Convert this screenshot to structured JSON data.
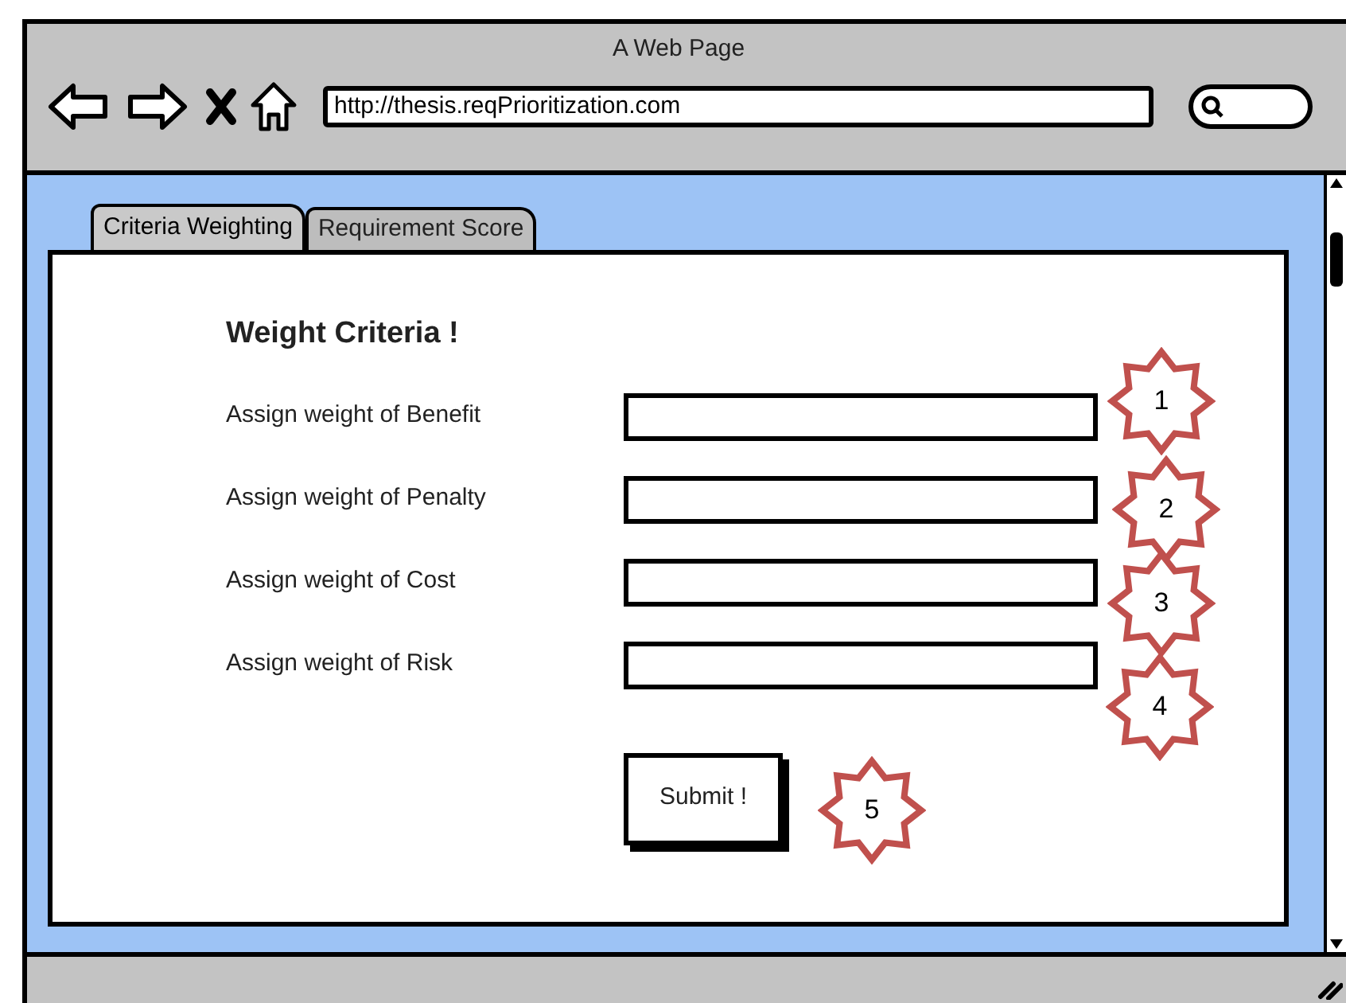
{
  "window": {
    "title": "A Web Page"
  },
  "address_bar": {
    "value": "http://thesis.reqPrioritization.com"
  },
  "tabs": [
    {
      "label": "Criteria Weighting",
      "selected": true
    },
    {
      "label": "Requirement Score",
      "selected": false
    }
  ],
  "form": {
    "heading": "Weight Criteria !",
    "fields": [
      {
        "label": "Assign weight of Benefit",
        "marker": "1"
      },
      {
        "label": "Assign weight of Penalty",
        "marker": "2"
      },
      {
        "label": "Assign weight of Cost",
        "marker": "3"
      },
      {
        "label": "Assign weight of Risk",
        "marker": "4"
      }
    ],
    "submit": {
      "label": "Submit !",
      "marker": "5"
    }
  }
}
